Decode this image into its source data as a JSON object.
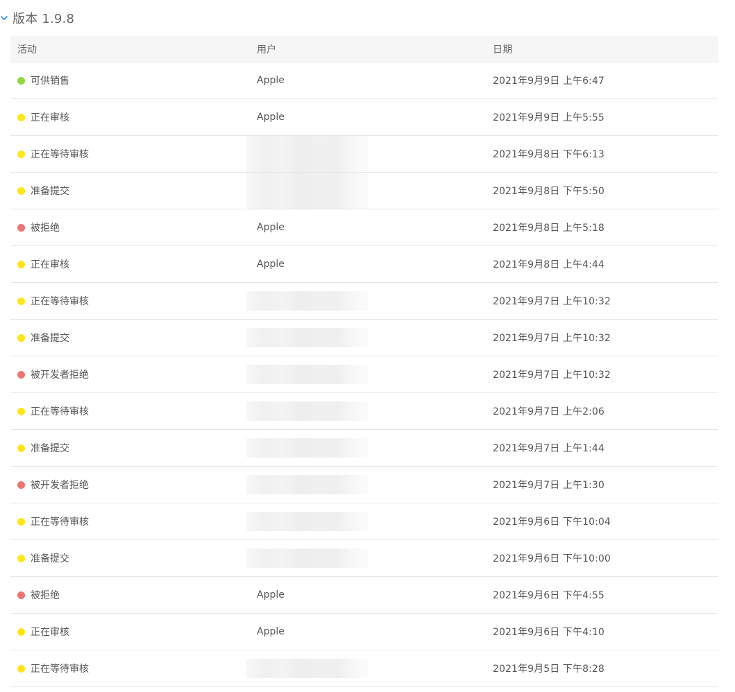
{
  "version": {
    "title": "版本 1.9.8"
  },
  "colors": {
    "green": "#8fd843",
    "yellow": "#ffe61c",
    "red": "#ee7474",
    "accent": "#1a8cff"
  },
  "table": {
    "headers": {
      "activity": "活动",
      "user": "用户",
      "date": "日期"
    },
    "rows": [
      {
        "status": "green",
        "activity": "可供销售",
        "user": "Apple",
        "date": "2021年9月9日 上午6:47"
      },
      {
        "status": "yellow",
        "activity": "正在审核",
        "user": "Apple",
        "date": "2021年9月9日 上午5:55"
      },
      {
        "status": "yellow",
        "activity": "正在等待审核",
        "user": "",
        "redacted": "tall",
        "date": "2021年9月8日 下午6:13"
      },
      {
        "status": "yellow",
        "activity": "准备提交",
        "user": "",
        "redacted": "tall",
        "date": "2021年9月8日 下午5:50"
      },
      {
        "status": "red",
        "activity": "被拒绝",
        "user": "Apple",
        "date": "2021年9月8日 上午5:18"
      },
      {
        "status": "yellow",
        "activity": "正在审核",
        "user": "Apple",
        "date": "2021年9月8日 上午4:44"
      },
      {
        "status": "yellow",
        "activity": "正在等待审核",
        "user": "",
        "redacted": "short",
        "date": "2021年9月7日 上午10:32"
      },
      {
        "status": "yellow",
        "activity": "准备提交",
        "user": "",
        "redacted": "short",
        "date": "2021年9月7日 上午10:32"
      },
      {
        "status": "red",
        "activity": "被开发者拒绝",
        "user": "",
        "redacted": "short",
        "date": "2021年9月7日 上午10:32"
      },
      {
        "status": "yellow",
        "activity": "正在等待审核",
        "user": "",
        "redacted": "short",
        "date": "2021年9月7日 上午2:06"
      },
      {
        "status": "yellow",
        "activity": "准备提交",
        "user": "",
        "redacted": "short",
        "date": "2021年9月7日 上午1:44"
      },
      {
        "status": "red",
        "activity": "被开发者拒绝",
        "user": "",
        "redacted": "short",
        "date": "2021年9月7日 上午1:30"
      },
      {
        "status": "yellow",
        "activity": "正在等待审核",
        "user": "",
        "redacted": "short",
        "date": "2021年9月6日 下午10:04"
      },
      {
        "status": "yellow",
        "activity": "准备提交",
        "user": "",
        "redacted": "short",
        "date": "2021年9月6日 下午10:00"
      },
      {
        "status": "red",
        "activity": "被拒绝",
        "user": "Apple",
        "date": "2021年9月6日 下午4:55"
      },
      {
        "status": "yellow",
        "activity": "正在审核",
        "user": "Apple",
        "date": "2021年9月6日 下午4:10"
      },
      {
        "status": "yellow",
        "activity": "正在等待审核",
        "user": "",
        "redacted": "short",
        "date": "2021年9月5日 下午8:28"
      }
    ]
  }
}
